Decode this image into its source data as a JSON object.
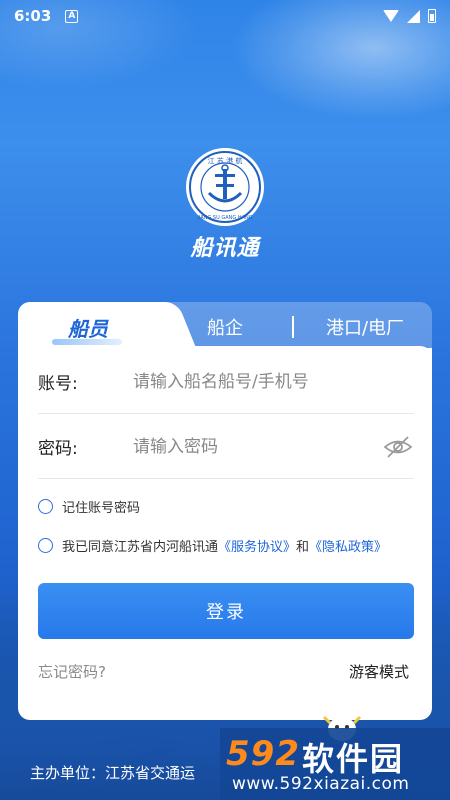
{
  "status_bar": {
    "time": "6:03",
    "notification_glyph": "A"
  },
  "logo": {
    "seal_text": "江 苏 港 航",
    "seal_text_en": "JIANG SU GANG HANG",
    "emblem": "anchor-icon"
  },
  "app_name": "船讯通",
  "tabs": [
    {
      "label": "船员",
      "active": true
    },
    {
      "label": "船企",
      "active": false
    },
    {
      "label": "港口/电厂",
      "active": false
    }
  ],
  "form": {
    "account_label": "账号:",
    "account_placeholder": "请输入船名船号/手机号",
    "password_label": "密码:",
    "password_placeholder": "请输入密码",
    "remember_label": "记住账号密码",
    "agree_prefix": "我已同意江苏省内河船讯通",
    "service_link": "《服务协议》",
    "agree_and": "和",
    "privacy_link": "《隐私政策》",
    "login_button": "登录",
    "forgot_link": "忘记密码?",
    "guest_link": "游客模式"
  },
  "footer": {
    "text": "主办单位：江苏省交通运"
  },
  "watermark": {
    "brand_number": "592",
    "brand_cn": "软件园",
    "url": "www.592xiazai.com"
  },
  "colors": {
    "primary": "#2779ea",
    "link": "#1e66d8",
    "background": "#2a73dd"
  }
}
